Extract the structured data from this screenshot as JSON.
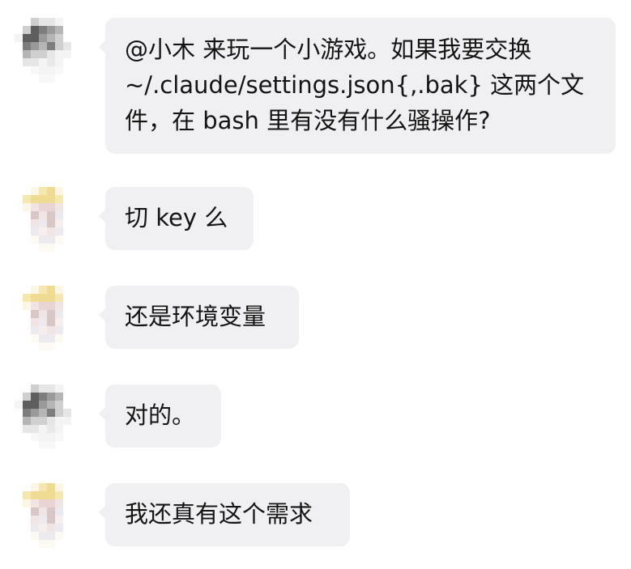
{
  "messages": [
    {
      "avatar_style": "gray",
      "lines": [
        "@小木 来玩一个小游戏。如果我要交换",
        "~/.claude/settings.json{,.bak} 这两个文",
        "件，在 bash 里有没有什么骚操作?"
      ]
    },
    {
      "avatar_style": "yellow",
      "lines": [
        "切 key 么"
      ]
    },
    {
      "avatar_style": "yellow",
      "lines": [
        "还是环境变量"
      ]
    },
    {
      "avatar_style": "gray",
      "lines": [
        "对的。"
      ]
    },
    {
      "avatar_style": "yellow",
      "lines": [
        "我还真有这个需求"
      ]
    }
  ],
  "colors": {
    "bubble_bg": "#f0f0f2",
    "text": "#141414",
    "background": "#ffffff"
  }
}
